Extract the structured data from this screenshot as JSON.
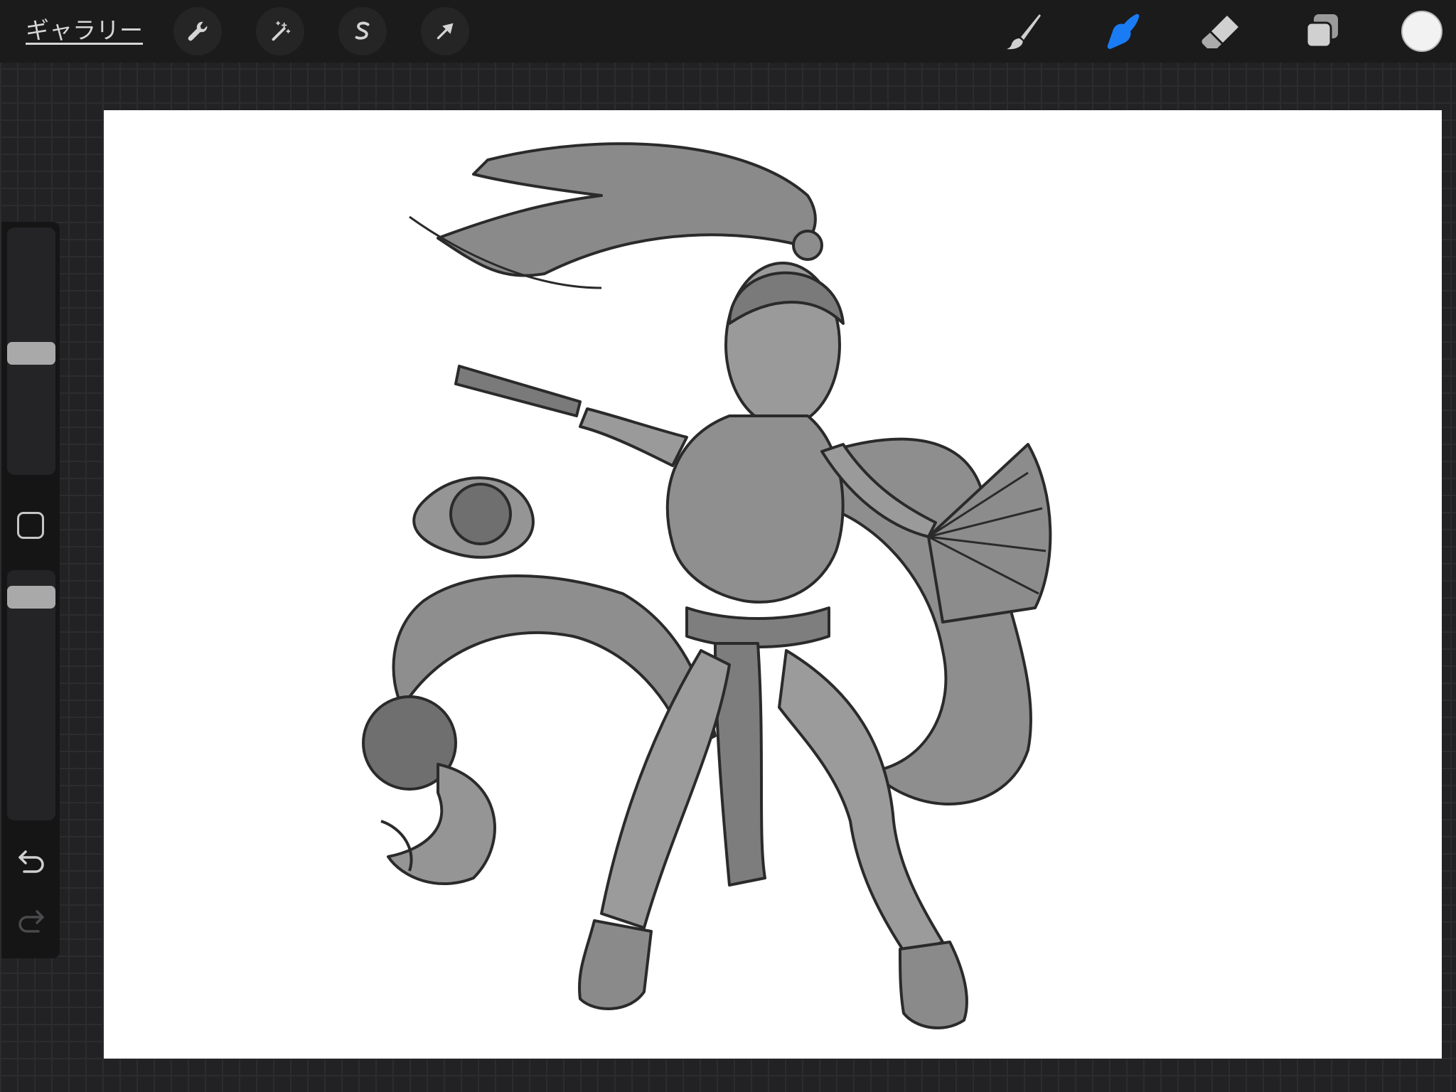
{
  "app": {
    "gallery_label": "ギャラリー"
  },
  "toolbar": {
    "left_tools": [
      {
        "name": "actions",
        "icon": "wrench-icon"
      },
      {
        "name": "adjustments",
        "icon": "magic-wand-icon"
      },
      {
        "name": "selection",
        "icon": "selection-s-icon"
      },
      {
        "name": "transform",
        "icon": "arrow-cursor-icon"
      }
    ],
    "right_tools": [
      {
        "name": "brush",
        "icon": "brush-icon"
      },
      {
        "name": "smudge",
        "icon": "smudge-icon",
        "active": true
      },
      {
        "name": "eraser",
        "icon": "eraser-icon"
      },
      {
        "name": "layers",
        "icon": "layers-icon"
      }
    ],
    "current_color": "#f2f2f2",
    "accent_color": "#1a7cf5"
  },
  "sidebar": {
    "brush_size_level": 0.49,
    "opacity_level": 0.93,
    "undo_icon": "undo-icon",
    "redo_icon": "redo-icon"
  }
}
